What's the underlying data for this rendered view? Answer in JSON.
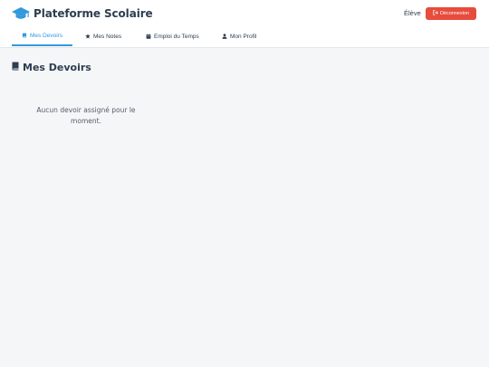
{
  "header": {
    "title": "Plateforme Scolaire",
    "role": "Élève",
    "logout_label": "Déconnexion"
  },
  "nav": {
    "tabs": [
      {
        "label": "Mes Devoirs",
        "icon": "book-icon",
        "active": true
      },
      {
        "label": "Mes Notes",
        "icon": "star-icon",
        "active": false
      },
      {
        "label": "Emploi du Temps",
        "icon": "calendar-icon",
        "active": false
      },
      {
        "label": "Mon Profil",
        "icon": "user-icon",
        "active": false
      }
    ]
  },
  "main": {
    "title": "Mes Devoirs",
    "empty_message": "Aucun devoir assigné pour le moment."
  },
  "colors": {
    "primary": "#3498db",
    "danger": "#e74c3c",
    "text": "#2c3e50",
    "background": "#f5f6f8"
  }
}
